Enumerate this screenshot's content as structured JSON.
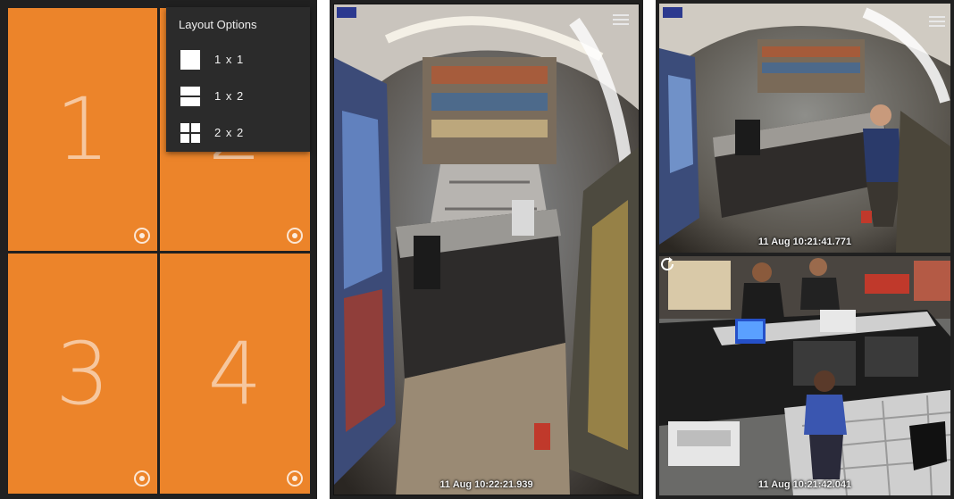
{
  "layout_menu": {
    "title": "Layout Options",
    "options": [
      {
        "label": "1 x 1",
        "icon": "single-pane-icon"
      },
      {
        "label": "1 x 2",
        "icon": "split-horizontal-icon"
      },
      {
        "label": "2 x 2",
        "icon": "grid-2x2-icon"
      }
    ]
  },
  "grid_panel": {
    "cells": [
      {
        "label": "1"
      },
      {
        "label": "2"
      },
      {
        "label": "3"
      },
      {
        "label": "4"
      }
    ],
    "accent_color": "#ec842a"
  },
  "single_view": {
    "timestamp": "11 Aug 10:22:21.939"
  },
  "split_view": {
    "top_timestamp": "11 Aug 10:21:41.771",
    "bottom_timestamp": "11 Aug 10:21:42.041"
  }
}
